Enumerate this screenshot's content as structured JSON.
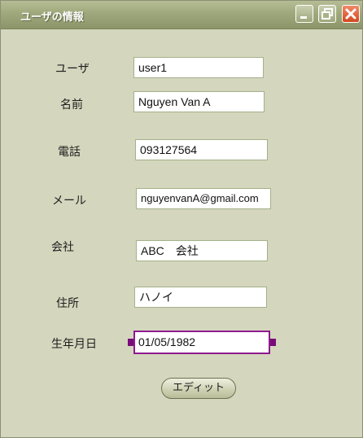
{
  "window": {
    "title": "ユーザの情報"
  },
  "form": {
    "user": {
      "label": "ユーザ",
      "value": "user1"
    },
    "name": {
      "label": "名前",
      "value": "Nguyen Van A"
    },
    "phone": {
      "label": "電話",
      "value": "093127564"
    },
    "mail": {
      "label": "メール",
      "value": "nguyenvanA@gmail.com"
    },
    "company": {
      "label": "会社",
      "value": "ABC　会社"
    },
    "address": {
      "label": "住所",
      "value": "ハノイ"
    },
    "birthday": {
      "label": "生年月日",
      "value": "01/05/1982"
    }
  },
  "actions": {
    "edit_label": "エディット"
  },
  "icons": {
    "minimize": "minimize-icon",
    "maximize": "restore-icon",
    "close": "close-icon"
  },
  "colors": {
    "background": "#d4d6bd",
    "titlebar": "#9fa87c",
    "focus": "#8e1a8e",
    "close": "#d2481f"
  }
}
